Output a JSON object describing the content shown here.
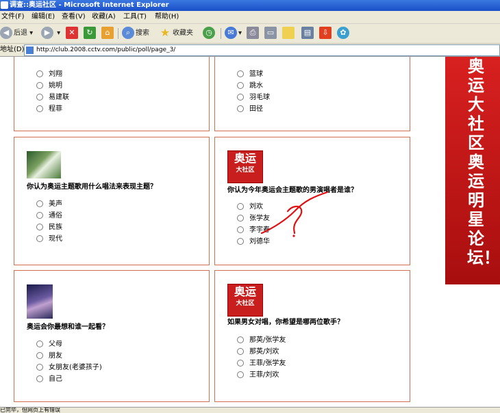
{
  "window": {
    "title": "调查::奥运社区 - Microsoft Internet Explorer"
  },
  "menu": [
    "文件(F)",
    "编辑(E)",
    "查看(V)",
    "收藏(A)",
    "工具(T)",
    "帮助(H)"
  ],
  "toolbar": {
    "back": "后退",
    "search": "搜索",
    "favorites": "收藏夹"
  },
  "address": {
    "label": "地址(D)",
    "url": "http://club.2008.cctv.com/public/poll/page_3/"
  },
  "polls": [
    {
      "question": "",
      "options": [
        "刘翔",
        "姚明",
        "易建联",
        "程菲"
      ]
    },
    {
      "question": "",
      "options": [
        "篮球",
        "跳水",
        "羽毛球",
        "田径"
      ]
    },
    {
      "question": "你认为奥运主题歌用什么唱法来表现主题？",
      "options": [
        "美声",
        "通俗",
        "民族",
        "现代"
      ]
    },
    {
      "question": "你认为今年奥运会主题歌的男演唱者是谁？",
      "options": [
        "刘欢",
        "张学友",
        "李宇春",
        "刘德华"
      ]
    },
    {
      "question": "奥运会你最想和谁一起看？",
      "options": [
        "父母",
        "朋友",
        "女朋友(老婆孩子)",
        "自己"
      ]
    },
    {
      "question": "如果男女对唱，你希望是哪两位歌手？",
      "options": [
        "那英/张学友",
        "那英/刘欢",
        "王菲/张学友",
        "王菲/刘欢"
      ]
    }
  ],
  "logo": {
    "main": "奥运",
    "sub": "大社区"
  },
  "banner": {
    "text": "奥运大社区奥运明星论坛！"
  },
  "status": {
    "text": "已完毕，但网页上有错误"
  },
  "colors": {
    "card_border": "#d07050",
    "banner": "#c81e1e",
    "scribble": "#e01010"
  }
}
